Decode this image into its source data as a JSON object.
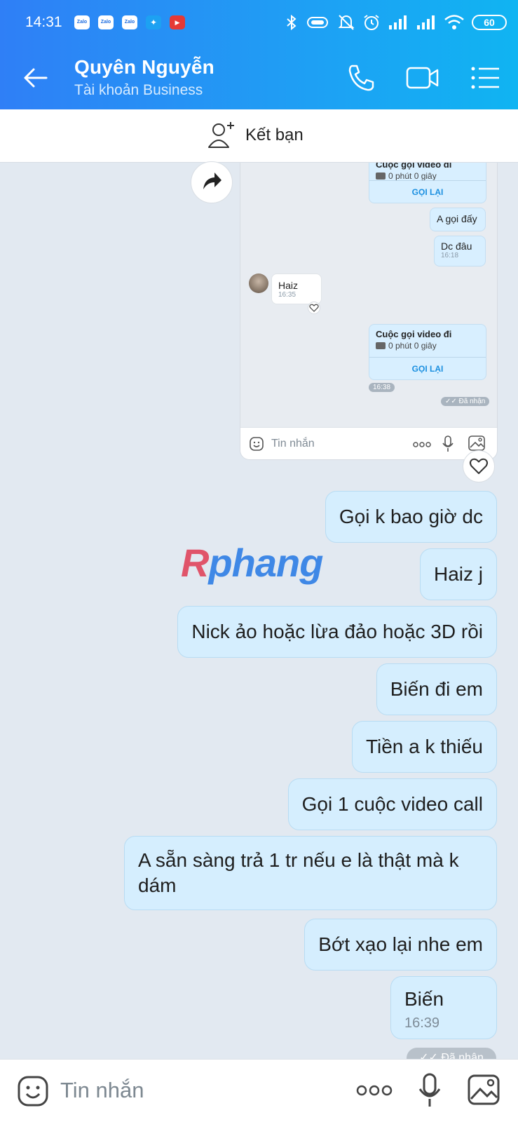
{
  "status_bar": {
    "time": "14:31",
    "notifications": [
      "Zalo",
      "Zalo",
      "Zalo",
      "twitter-icon",
      "youtube-icon"
    ],
    "battery": "60"
  },
  "header": {
    "contact_name": "Quyên Nguyễn",
    "account_type": "Tài khoản Business",
    "actions": [
      "back-arrow-icon",
      "phone-icon",
      "video-call-icon",
      "menu-icon"
    ]
  },
  "friend_bar": {
    "label": "Kết bạn"
  },
  "embedded_screenshot": {
    "call_1": {
      "title": "Cuộc gọi video đi",
      "duration": "0 phút 0 giây",
      "action": "GỌI LẠI"
    },
    "msg_1": {
      "text": "A gọi đấy"
    },
    "msg_2": {
      "text": "Dc đâu",
      "time": "16:18"
    },
    "incoming": {
      "text": "Haiz",
      "time": "16:35"
    },
    "call_2": {
      "title": "Cuộc gọi video đi",
      "duration": "0 phút 0 giây",
      "action": "GỌI LẠI",
      "time": "16:38"
    },
    "status": "Đã nhận",
    "input_placeholder": "Tin nhắn"
  },
  "messages": [
    {
      "text": "Gọi k bao giờ dc"
    },
    {
      "text": "Haiz j"
    },
    {
      "text": "Nick ảo hoặc lừa đảo hoặc 3D rồi"
    },
    {
      "text": "Biến đi em"
    },
    {
      "text": "Tiền a k thiếu"
    },
    {
      "text": "Gọi 1 cuộc video call"
    },
    {
      "text": "A sẵn sàng trả 1 tr nếu e là thật mà k dám"
    },
    {
      "text": "Bớt xạo lại nhe em"
    },
    {
      "text": "Biến",
      "time": "16:39"
    }
  ],
  "watermark": {
    "first": "R",
    "rest": "phang"
  },
  "delivery_status": "Đã nhận",
  "composer": {
    "placeholder": "Tin nhắn"
  }
}
